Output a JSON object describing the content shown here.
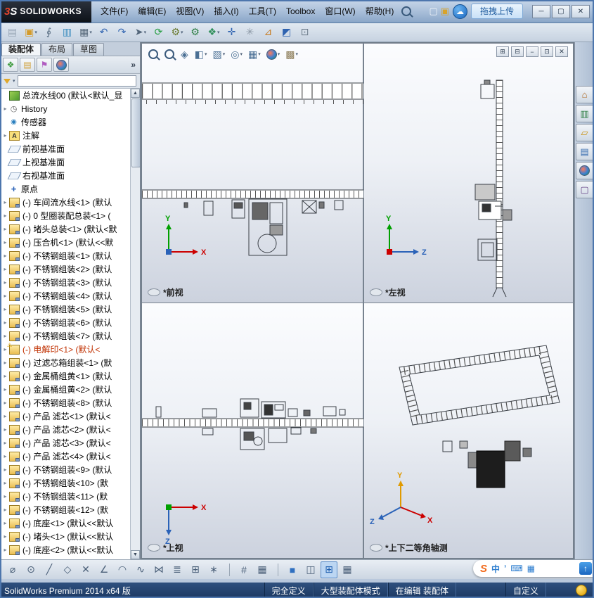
{
  "titlebar": {
    "logo": {
      "mark3": "3",
      "markS": "S",
      "name": "SOLIDWORKS"
    },
    "menus": [
      "文件(F)",
      "编辑(E)",
      "视图(V)",
      "插入(I)",
      "工具(T)",
      "Toolbox",
      "窗口(W)",
      "帮助(H)"
    ],
    "quick_icons": [
      {
        "name": "new-doc-icon",
        "glyph": "▢",
        "color": "#f2f6fa"
      },
      {
        "name": "open-folder-icon",
        "glyph": "▣",
        "color": "#d8a32a"
      }
    ],
    "cloud_glyph": "☁",
    "upload_label": "拖拽上传",
    "window_buttons": [
      {
        "name": "minimize-button",
        "glyph": "─"
      },
      {
        "name": "maximize-button",
        "glyph": "▢"
      },
      {
        "name": "close-button",
        "glyph": "✕"
      }
    ]
  },
  "main_toolbar": [
    {
      "name": "properties-icon",
      "glyph": "▤",
      "color": "#9aa8b8"
    },
    {
      "name": "open-icon",
      "glyph": "▣",
      "color": "#d49b2a",
      "caret": "▾"
    },
    {
      "name": "paperclip-icon",
      "glyph": "∮",
      "color": "#5a6f84"
    },
    {
      "name": "columns-icon",
      "glyph": "▥",
      "color": "#3f8fc0"
    },
    {
      "name": "print-icon",
      "glyph": "▦",
      "color": "#56687a",
      "caret": "▾"
    },
    {
      "name": "undo-icon",
      "glyph": "↶",
      "color": "#2f63b0"
    },
    {
      "name": "redo-icon",
      "glyph": "↷",
      "color": "#2f63b0"
    },
    {
      "name": "select-icon",
      "glyph": "➤",
      "color": "#53667a",
      "caret": "▾"
    },
    {
      "name": "rebuild-icon",
      "glyph": "⟳",
      "color": "#1f9b3c"
    },
    {
      "name": "options-icon",
      "glyph": "⚙",
      "color": "#6a7a2f",
      "caret": "▾"
    },
    {
      "name": "gears-icon",
      "glyph": "⚙",
      "color": "#2f7f46"
    },
    {
      "name": "insert-component-icon",
      "glyph": "❖",
      "color": "#2f8f5a",
      "caret": "▾"
    },
    {
      "name": "mate-icon",
      "glyph": "✛",
      "color": "#2f63b0"
    },
    {
      "name": "exploded-view-icon",
      "glyph": "✳",
      "color": "#8a97a5"
    },
    {
      "name": "measure-icon",
      "glyph": "⊿",
      "color": "#c77a1e"
    },
    {
      "name": "section-icon",
      "glyph": "◩",
      "color": "#2f63b0"
    },
    {
      "name": "screenshot-icon",
      "glyph": "⊡",
      "color": "#6b7a89"
    }
  ],
  "left_panel": {
    "tabs": [
      {
        "name": "tab-assembly",
        "label": "装配体",
        "cls": "active"
      },
      {
        "name": "tab-layout",
        "label": "布局"
      },
      {
        "name": "tab-sketch",
        "label": "草图"
      }
    ],
    "more": "»",
    "manager_icons": [
      {
        "name": "featuremanager-tab-icon",
        "glyph": "❖",
        "color": "#3f9b3f"
      },
      {
        "name": "propertymanager-tab-icon",
        "glyph": "▤",
        "color": "#d1a23a"
      },
      {
        "name": "configurationmanager-tab-icon",
        "glyph": "⚑",
        "color": "#b05cc0"
      },
      {
        "name": "displaymanager-tab-icon",
        "cls": "ball"
      }
    ],
    "filter_caret": "▾",
    "scroll_up": "▲",
    "scroll_down": "▼",
    "tree": [
      {
        "arrow": "",
        "icon": "root",
        "text": "总流水线00  (默认<默认_显"
      },
      {
        "arrow": "▸",
        "icon": "history",
        "text": "History"
      },
      {
        "arrow": "",
        "icon": "sensor",
        "text": "传感器"
      },
      {
        "arrow": "▸",
        "icon": "ann",
        "text": "注解"
      },
      {
        "arrow": "",
        "icon": "plane",
        "text": "前视基准面"
      },
      {
        "arrow": "",
        "icon": "plane",
        "text": "上视基准面"
      },
      {
        "arrow": "",
        "icon": "plane",
        "text": "右视基准面"
      },
      {
        "arrow": "",
        "icon": "origin",
        "text": "原点"
      },
      {
        "arrow": "▸",
        "icon": "comp",
        "text": "(-) 车间流水线<1> (默认"
      },
      {
        "arrow": "▸",
        "icon": "comp",
        "text": "(-) 0 型圈装配总装<1> ("
      },
      {
        "arrow": "▸",
        "icon": "comp",
        "text": "(-) 堵头总装<1> (默认<默"
      },
      {
        "arrow": "▸",
        "icon": "comp",
        "text": "(-) 压合机<1> (默认<<默"
      },
      {
        "arrow": "▸",
        "icon": "comp",
        "text": "(-) 不锈钢组装<1> (默认"
      },
      {
        "arrow": "▸",
        "icon": "comp",
        "text": "(-) 不锈钢组装<2> (默认"
      },
      {
        "arrow": "▸",
        "icon": "comp",
        "text": "(-) 不锈钢组装<3> (默认"
      },
      {
        "arrow": "▸",
        "icon": "comp",
        "text": "(-) 不锈钢组装<4> (默认"
      },
      {
        "arrow": "▸",
        "icon": "comp",
        "text": "(-) 不锈钢组装<5> (默认"
      },
      {
        "arrow": "▸",
        "icon": "comp",
        "text": "(-) 不锈钢组装<6> (默认"
      },
      {
        "arrow": "▸",
        "icon": "comp",
        "text": "(-) 不锈钢组装<7> (默认"
      },
      {
        "arrow": "▸",
        "icon": "comp",
        "cls": "warn",
        "text": "(-) 电解印<1> (默认<"
      },
      {
        "arrow": "▸",
        "icon": "comp",
        "text": "(-) 过滤芯箱组装<1> (默"
      },
      {
        "arrow": "▸",
        "icon": "comp",
        "text": "(-) 金属桶组黄<1> (默认"
      },
      {
        "arrow": "▸",
        "icon": "comp",
        "text": "(-) 金属桶组黄<2> (默认"
      },
      {
        "arrow": "▸",
        "icon": "comp",
        "text": "(-) 不锈钢组装<8> (默认"
      },
      {
        "arrow": "▸",
        "icon": "comp",
        "text": "(-) 产品 滤芯<1> (默认<"
      },
      {
        "arrow": "▸",
        "icon": "comp",
        "text": "(-) 产品 滤芯<2> (默认<"
      },
      {
        "arrow": "▸",
        "icon": "comp",
        "text": "(-) 产品 滤芯<3> (默认<"
      },
      {
        "arrow": "▸",
        "icon": "comp",
        "text": "(-) 产品 滤芯<4> (默认<"
      },
      {
        "arrow": "▸",
        "icon": "comp",
        "text": "(-) 不锈钢组装<9> (默认"
      },
      {
        "arrow": "▸",
        "icon": "comp",
        "text": "(-) 不锈钢组装<10> (默"
      },
      {
        "arrow": "▸",
        "icon": "comp",
        "text": "(-) 不锈钢组装<11> (默"
      },
      {
        "arrow": "▸",
        "icon": "comp",
        "text": "(-) 不锈钢组装<12> (默"
      },
      {
        "arrow": "▸",
        "icon": "comp",
        "text": "(-) 底座<1> (默认<<默认"
      },
      {
        "arrow": "▸",
        "icon": "comp",
        "text": "(-) 堵头<1> (默认<<默认"
      },
      {
        "arrow": "▸",
        "icon": "comp",
        "text": "(-) 底座<2> (默认<<默认"
      }
    ]
  },
  "viewport": {
    "hud": [
      {
        "name": "zoom-fit-icon",
        "cls": "mag"
      },
      {
        "name": "zoom-area-icon",
        "cls": "mag"
      },
      {
        "name": "previous-view-icon",
        "glyph": "◈",
        "color": "#4a6f94"
      },
      {
        "name": "section-view-icon",
        "glyph": "◧",
        "color": "#4a6f94",
        "caret": "▾"
      },
      {
        "name": "display-style-icon",
        "glyph": "▧",
        "color": "#4a6f94",
        "caret": "▾"
      },
      {
        "name": "hide-show-icon",
        "glyph": "◎",
        "color": "#4a6f94",
        "caret": "▾"
      },
      {
        "name": "view-orientation-icon",
        "glyph": "▦",
        "color": "#4a6f94",
        "caret": "▾"
      },
      {
        "name": "appearance-icon",
        "cls": "ball",
        "caret": "▾"
      },
      {
        "name": "scene-icon",
        "glyph": "▩",
        "color": "#8a7a55",
        "caret": "▾"
      }
    ],
    "win_controls": [
      {
        "name": "viewport-tile-icon",
        "glyph": "⊞"
      },
      {
        "name": "viewport-cascade-icon",
        "glyph": "⊟"
      },
      {
        "name": "viewport-minimize-icon",
        "glyph": "−"
      },
      {
        "name": "viewport-restore-icon",
        "glyph": "⊡"
      },
      {
        "name": "viewport-close-icon",
        "glyph": "✕"
      }
    ],
    "axis": {
      "x": "X",
      "y": "Y",
      "z": "Z"
    },
    "views": {
      "front": "*前视",
      "left": "*左视",
      "top": "*上视",
      "iso": "*上下二等角轴测"
    }
  },
  "taskpane": [
    {
      "name": "home-icon",
      "glyph": "⌂",
      "color": "#b06820"
    },
    {
      "name": "stats-icon",
      "glyph": "▥",
      "color": "#2f7f46"
    },
    {
      "name": "folder-icon",
      "glyph": "▱",
      "color": "#c89010"
    },
    {
      "name": "design-library-icon",
      "glyph": "▤",
      "color": "#3a6fb0"
    },
    {
      "name": "appearances-icon",
      "cls": "ball"
    },
    {
      "name": "custom-properties-icon",
      "glyph": "▢",
      "color": "#6a4a8a"
    }
  ],
  "sketchbar": {
    "tools": [
      {
        "name": "smart-dimension-icon",
        "glyph": "⌀",
        "color": "#4a5f78"
      },
      {
        "name": "circle-tool-icon",
        "glyph": "⊙",
        "color": "#4a5f78"
      },
      {
        "name": "line-tool-icon",
        "glyph": "╱",
        "color": "#4a5f78"
      },
      {
        "name": "polygon-tool-icon",
        "glyph": "◇",
        "color": "#4a5f78"
      },
      {
        "name": "trim-tool-icon",
        "glyph": "✕",
        "color": "#4a5f78"
      },
      {
        "name": "angle-tool-icon",
        "glyph": "∠",
        "color": "#4a5f78"
      },
      {
        "name": "arc-tool-icon",
        "glyph": "◠",
        "color": "#4a5f78"
      },
      {
        "name": "spline-tool-icon",
        "glyph": "∿",
        "color": "#4a5f78"
      },
      {
        "name": "mirror-tool-icon",
        "glyph": "⋈",
        "color": "#4a5f78"
      },
      {
        "name": "offset-tool-icon",
        "glyph": "≣",
        "color": "#4a5f78"
      },
      {
        "name": "pattern-tool-icon",
        "glyph": "⊞",
        "color": "#4a5f78"
      },
      {
        "name": "move-tool-icon",
        "glyph": "∗",
        "color": "#4a5f78"
      }
    ],
    "grid": [
      {
        "name": "snap-grid-icon",
        "glyph": "#",
        "color": "#4a5f78"
      },
      {
        "name": "grid-settings-icon",
        "glyph": "▦",
        "color": "#4a5f78"
      }
    ],
    "layouts": [
      {
        "name": "single-view-button",
        "glyph": "■",
        "color": "#2f6fc0"
      },
      {
        "name": "two-view-button",
        "glyph": "◫",
        "color": "#4a5f78"
      },
      {
        "name": "four-view-button",
        "glyph": "⊞",
        "color": "#1f5fb0",
        "cls": "active"
      },
      {
        "name": "table-view-button",
        "glyph": "▦",
        "color": "#4a5f78"
      }
    ]
  },
  "ime": [
    {
      "name": "sogou-logo-icon",
      "glyph": "S",
      "cls": "sogou"
    },
    {
      "name": "ime-lang-icon",
      "glyph": "中"
    },
    {
      "name": "ime-punct-icon",
      "glyph": "’"
    },
    {
      "name": "ime-keyboard-icon",
      "glyph": "⌨"
    },
    {
      "name": "ime-toolbox-icon",
      "glyph": "▦"
    },
    {
      "name": "ime-up-icon",
      "glyph": "↑",
      "cls": "up"
    }
  ],
  "statusbar": {
    "app": "SolidWorks Premium 2014 x64 版",
    "state": "完全定义",
    "mode": "大型装配体模式",
    "editing": "在编辑  装配体",
    "custom": "自定义"
  }
}
